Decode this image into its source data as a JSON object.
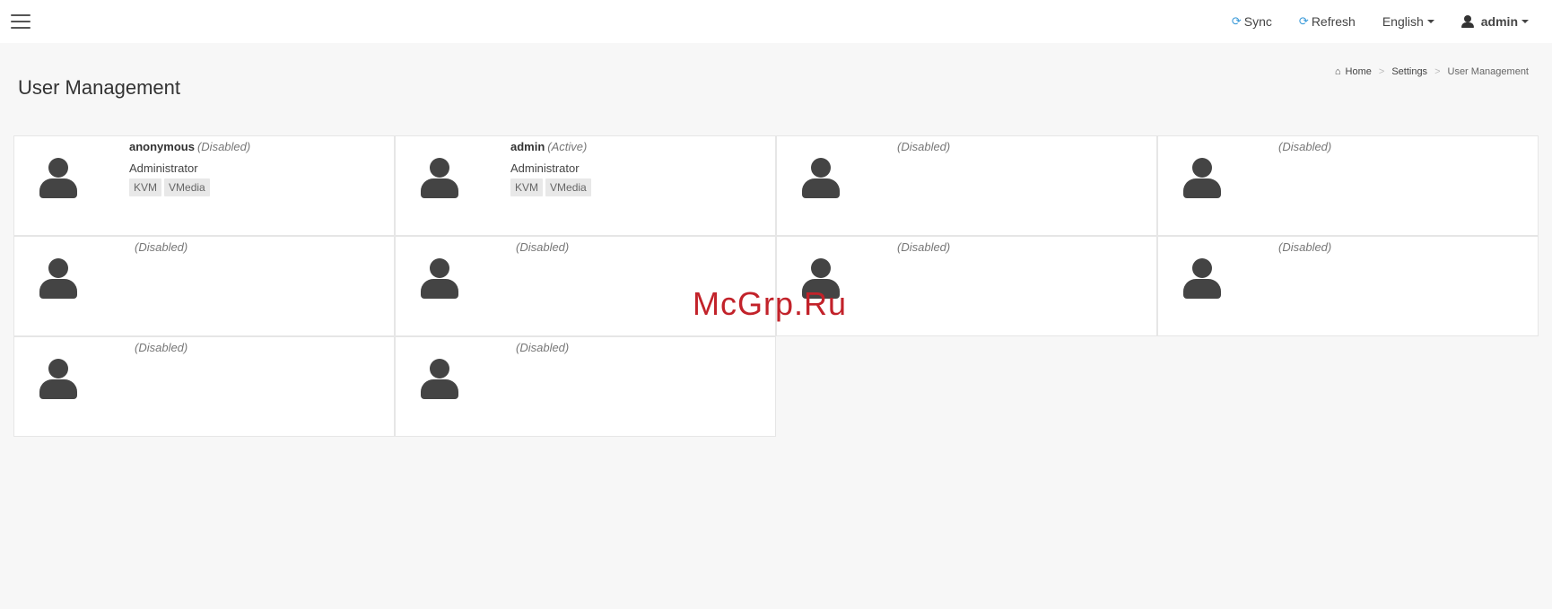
{
  "topbar": {
    "sync_label": "Sync",
    "refresh_label": "Refresh",
    "language_label": "English",
    "user_label": "admin"
  },
  "page": {
    "title": "User Management",
    "watermark": "McGrp.Ru"
  },
  "breadcrumb": {
    "home": "Home",
    "settings": "Settings",
    "current": "User Management"
  },
  "users": [
    {
      "name": "anonymous",
      "status": "(Disabled)",
      "role": "Administrator",
      "tags": [
        "KVM",
        "VMedia"
      ]
    },
    {
      "name": "admin",
      "status": "(Active)",
      "role": "Administrator",
      "tags": [
        "KVM",
        "VMedia"
      ]
    },
    {
      "name": "",
      "status": "(Disabled)"
    },
    {
      "name": "",
      "status": "(Disabled)"
    },
    {
      "name": "",
      "status": "(Disabled)"
    },
    {
      "name": "",
      "status": "(Disabled)"
    },
    {
      "name": "",
      "status": "(Disabled)"
    },
    {
      "name": "",
      "status": "(Disabled)"
    },
    {
      "name": "",
      "status": "(Disabled)"
    },
    {
      "name": "",
      "status": "(Disabled)"
    }
  ],
  "icons": {
    "menu": "hamburger-menu-icon",
    "sync": "sync-icon",
    "refresh": "refresh-icon",
    "user": "user-icon",
    "home": "home-icon",
    "avatar": "user-avatar-icon"
  },
  "colors": {
    "accent": "#3a9ad9",
    "watermark": "#c2222a",
    "avatar": "#444444"
  }
}
